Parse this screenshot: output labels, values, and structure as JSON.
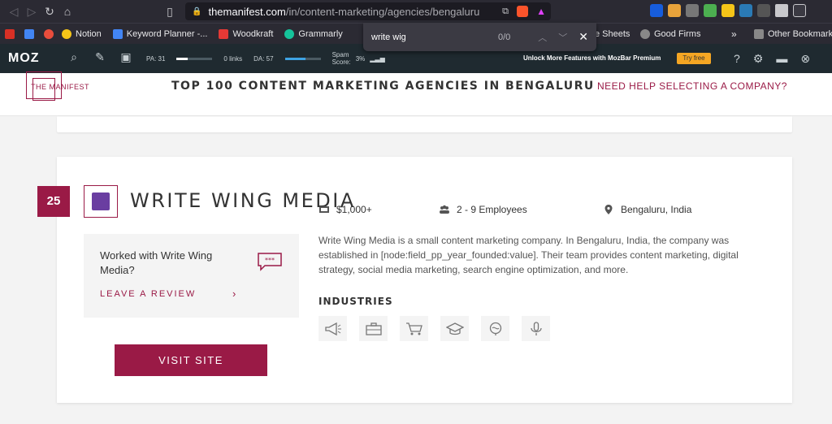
{
  "browser": {
    "url_host": "themanifest.com",
    "url_path": "/in/content-marketing/agencies/bengaluru",
    "bookmarks": [
      {
        "label": "Notion"
      },
      {
        "label": "Keyword Planner -..."
      },
      {
        "label": "Woodkraft"
      },
      {
        "label": "Grammarly"
      },
      {
        "label": "e Sheets"
      },
      {
        "label": "Good Firms"
      },
      {
        "label": "Other Bookmarks"
      }
    ],
    "more_bookmarks": "»"
  },
  "findbar": {
    "query": "write wig",
    "count": "0/0"
  },
  "mozbar": {
    "logo": "MOZ",
    "pa": "PA: 31",
    "pa_fraction": 0.31,
    "links": "0 links",
    "da": "DA: 57",
    "da_fraction": 0.57,
    "spam_label": "Spam\nScore:",
    "spam_value": "3%",
    "premium": "Unlock More Features with MozBar Premium",
    "try_free": "Try free"
  },
  "site": {
    "logo": "THE MANIFEST",
    "title": "TOP 100 CONTENT MARKETING AGENCIES IN BENGALURU",
    "need_help": "NEED HELP SELECTING A COMPANY?"
  },
  "company": {
    "rank": "25",
    "name": "WRITE WING MEDIA",
    "review_question": "Worked with Write Wing Media?",
    "leave_review": "LEAVE A REVIEW",
    "visit_site": "VISIT SITE",
    "min_project": "$1,000+",
    "employees": "2 - 9 Employees",
    "location": "Bengaluru, India",
    "description": "Write Wing Media is a small content marketing company. In Bengaluru, India, the company was established in [node:field_pp_year_founded:value]. Their team provides content marketing, digital strategy, social media marketing, search engine optimization, and more.",
    "industries_label": "INDUSTRIES",
    "industries": [
      {
        "icon": "megaphone-icon"
      },
      {
        "icon": "briefcase-icon"
      },
      {
        "icon": "shopping-cart-icon"
      },
      {
        "icon": "graduation-cap-icon"
      },
      {
        "icon": "brain-icon"
      },
      {
        "icon": "microphone-icon"
      }
    ]
  },
  "colors": {
    "brand": "#9a1a46",
    "moz_bg": "#1f2a30",
    "chrome_bg": "#2b2a33"
  }
}
